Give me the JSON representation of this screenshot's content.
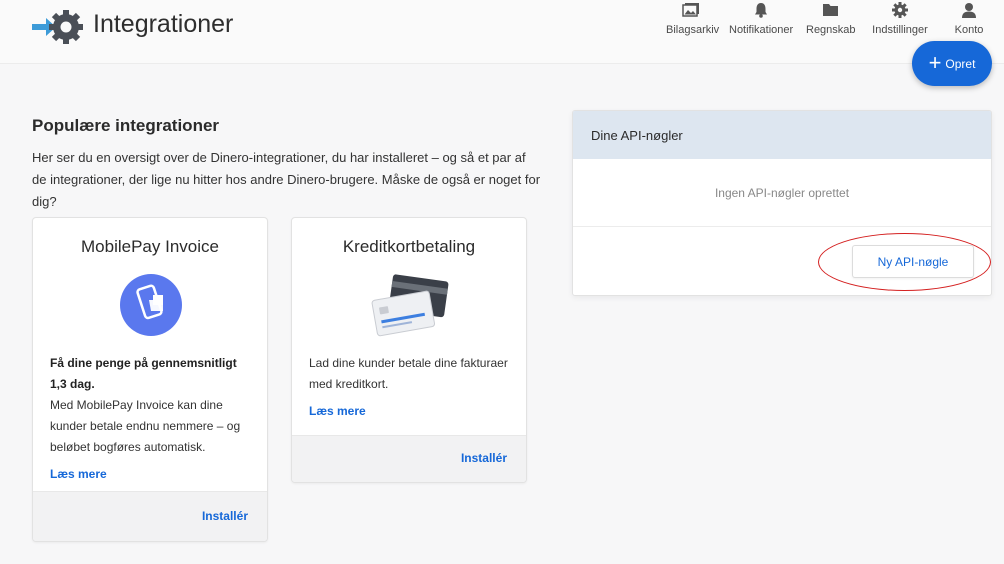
{
  "header": {
    "title": "Integrationer",
    "nav": [
      {
        "label": "Bilagsarkiv",
        "icon": "photo-archive-icon"
      },
      {
        "label": "Notifikationer",
        "icon": "bell-icon"
      },
      {
        "label": "Regnskab",
        "icon": "folder-icon"
      },
      {
        "label": "Indstillinger",
        "icon": "gear-icon"
      },
      {
        "label": "Konto",
        "icon": "user-icon"
      }
    ],
    "create_label": "Opret"
  },
  "popular": {
    "title": "Populære integrationer",
    "description": "Her ser du en oversigt over de Dinero-integrationer, du har installeret – og så et par af de integrationer, der lige nu hitter hos andre Dinero-brugere. Måske de også er noget for dig?"
  },
  "cards": [
    {
      "title": "MobilePay Invoice",
      "icon": "mobilepay-icon",
      "bold_text": "Få dine penge på gennemsnitligt 1,3 dag.",
      "text": "Med MobilePay Invoice kan dine kunder betale endnu nemmere – og beløbet bogføres automatisk.",
      "link": "Læs mere",
      "install": "Installér"
    },
    {
      "title": "Kreditkortbetaling",
      "icon": "credit-cards-icon",
      "text": "Lad dine kunder betale dine fakturaer med kreditkort.",
      "link": "Læs mere",
      "install": "Installér"
    }
  ],
  "api": {
    "title": "Dine API-nøgler",
    "empty": "Ingen API-nøgler oprettet",
    "button": "Ny API-nøgle"
  },
  "colors": {
    "accent": "#1668d8",
    "mobilepay": "#5a78ee",
    "annotation": "#d42020"
  }
}
